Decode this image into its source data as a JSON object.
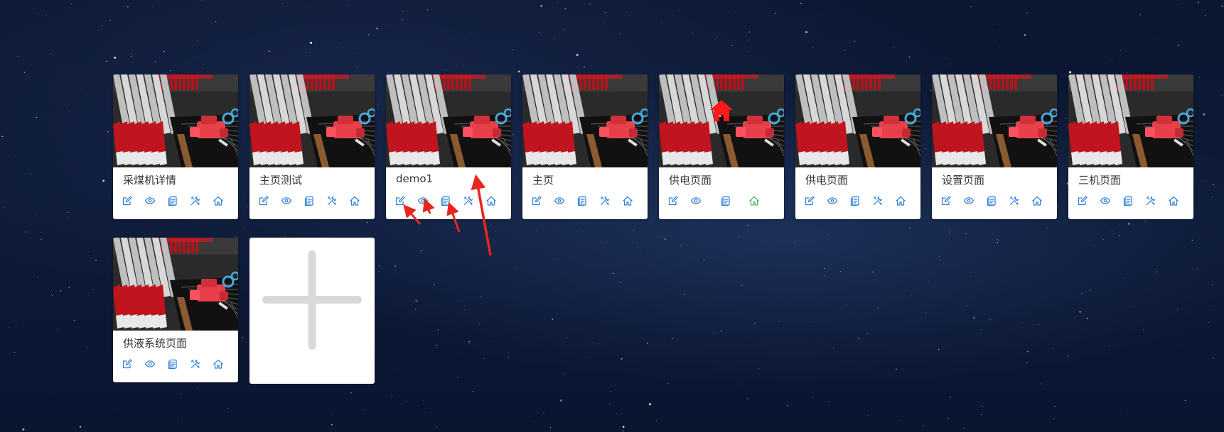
{
  "colors": {
    "action_icon": "#2f7fd8",
    "home_active": "#4caf50",
    "home_badge": "#ff1a1a",
    "annotation_arrow": "#e8261c",
    "add_plus": "#d9d9d9"
  },
  "cards": [
    {
      "title": "采煤机详情",
      "is_home": false
    },
    {
      "title": "主页测试",
      "is_home": false
    },
    {
      "title": "demo1",
      "is_home": false
    },
    {
      "title": "主页",
      "is_home": false
    },
    {
      "title": "供电页面",
      "is_home": true
    },
    {
      "title": "供电页面",
      "is_home": false
    },
    {
      "title": "设置页面",
      "is_home": false
    },
    {
      "title": "三机页面",
      "is_home": false
    },
    {
      "title": "供液系统页面",
      "is_home": false
    }
  ],
  "actions": [
    "edit-icon",
    "view-icon",
    "copy-icon",
    "settings-icon",
    "set-home-icon"
  ],
  "add_card": {
    "icon": "plus-icon"
  }
}
